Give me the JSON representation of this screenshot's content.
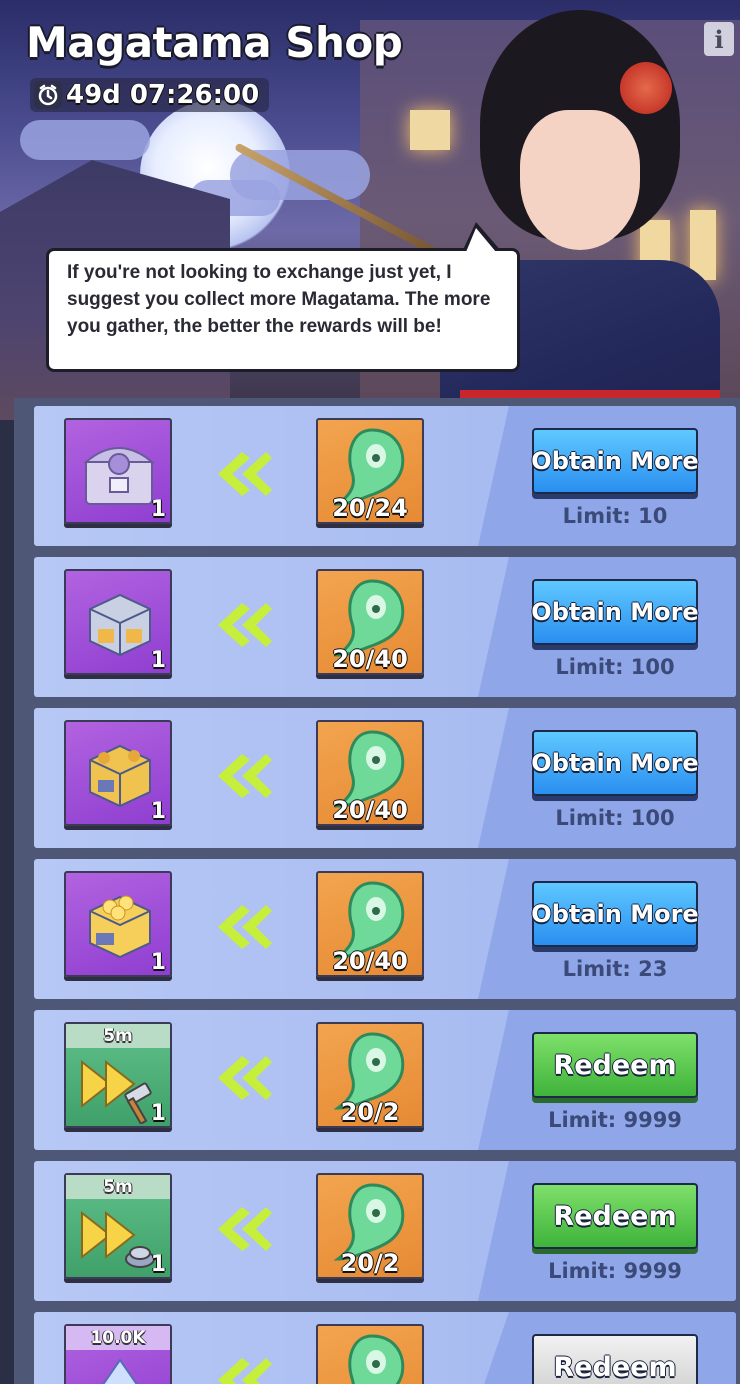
{
  "header": {
    "title": "Magatama Shop",
    "timer": "49d 07:26:00",
    "info_label": "i",
    "speech": "If you're not looking to exchange just yet, I suggest you collect more Magatama. The more you gather, the better the rewards will be!"
  },
  "items": [
    {
      "reward": "chest-lilac",
      "qty": "1",
      "tag": "",
      "cost": "20/24",
      "button": "Obtain More",
      "button_style": "blue",
      "limit": "Limit: 10"
    },
    {
      "reward": "crate-silver",
      "qty": "1",
      "tag": "",
      "cost": "20/40",
      "button": "Obtain More",
      "button_style": "blue",
      "limit": "Limit: 100"
    },
    {
      "reward": "crate-gold",
      "qty": "1",
      "tag": "",
      "cost": "20/40",
      "button": "Obtain More",
      "button_style": "blue",
      "limit": "Limit: 100"
    },
    {
      "reward": "crate-gold-coins",
      "qty": "1",
      "tag": "",
      "cost": "20/40",
      "button": "Obtain More",
      "button_style": "blue",
      "limit": "Limit: 23"
    },
    {
      "reward": "speedup-hammer",
      "qty": "1",
      "tag": "5m",
      "cost": "20/2",
      "button": "Redeem",
      "button_style": "green",
      "limit": "Limit: 9999"
    },
    {
      "reward": "speedup-research",
      "qty": "1",
      "tag": "5m",
      "cost": "20/2",
      "button": "Redeem",
      "button_style": "green",
      "limit": "Limit: 9999"
    },
    {
      "reward": "crystal",
      "qty": "",
      "tag": "10.0K",
      "cost": "",
      "button": "Redeem",
      "button_style": "grey",
      "limit": ""
    }
  ],
  "colors": {
    "row_bg": "#b7c8f5",
    "button_blue": "#2a8ff0",
    "button_green": "#3fb33a",
    "cost_bg": "#e68a34",
    "reward_purple": "#8f3ed0",
    "magatama": "#5fd08a",
    "arrow": "#c5ef3a"
  }
}
